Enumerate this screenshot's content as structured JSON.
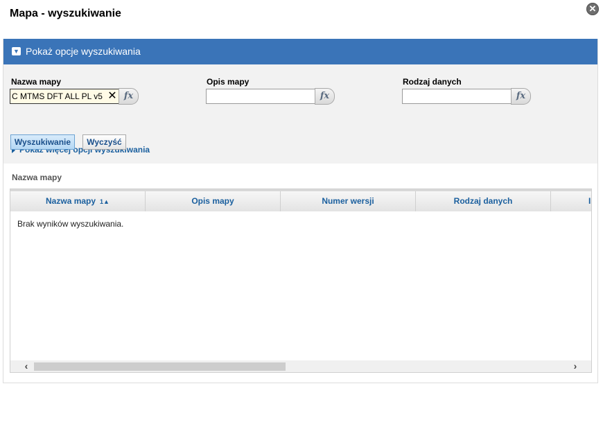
{
  "dialog": {
    "title": "Mapa - wyszukiwanie",
    "close_icon": "close-icon"
  },
  "search_panel": {
    "header_label": "Pokaż opcje wyszukiwania",
    "fields": {
      "map_name": {
        "label": "Nazwa mapy",
        "value": "C MTMS DFT ALL PL v5"
      },
      "map_description": {
        "label": "Opis mapy",
        "value": ""
      },
      "data_type": {
        "label": "Rodzaj danych",
        "value": ""
      }
    },
    "fx_label": "fx",
    "more_options_link": "Pokaż więcej opcji wyszukiwania",
    "search_button": "Wyszukiwanie",
    "clear_button": "Wyczyść"
  },
  "results": {
    "section_label": "Nazwa mapy",
    "columns": [
      {
        "label": "Nazwa mapy",
        "sort": "1▲"
      },
      {
        "label": "Opis mapy"
      },
      {
        "label": "Numer wersji"
      },
      {
        "label": "Rodzaj danych"
      },
      {
        "label": "I"
      }
    ],
    "empty_message": "Brak wyników wyszukiwania."
  },
  "colors": {
    "header_blue": "#3a74b8",
    "link_blue": "#1a5f9e"
  }
}
